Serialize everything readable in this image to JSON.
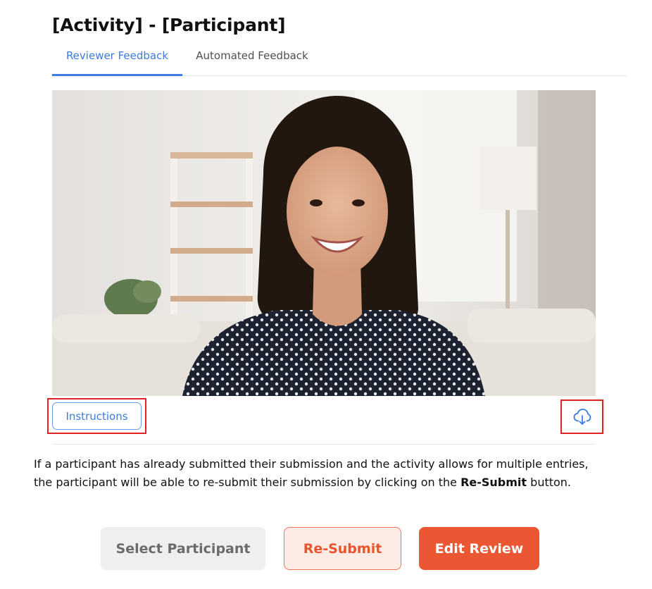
{
  "header": {
    "title": "[Activity] - [Participant]"
  },
  "tabs": [
    {
      "label": "Reviewer Feedback",
      "active": true
    },
    {
      "label": "Automated Feedback",
      "active": false
    }
  ],
  "media": {
    "subject": "smiling woman in polka-dot top sitting on a sofa",
    "instructions_label": "Instructions",
    "download_icon": "cloud-download-icon"
  },
  "description": {
    "line1": "If a participant has already submitted their submission and the activity allows for multiple entries,",
    "line2_prefix": "the participant will be able to re-submit their submission by clicking on the",
    "line2_bold": "Re-Submit",
    "line2_suffix": "button."
  },
  "actions": {
    "select_participant": "Select Participant",
    "resubmit": "Re-Submit",
    "edit_review": "Edit Review"
  },
  "colors": {
    "accent_blue": "#3d7be0",
    "highlight_red": "#e02424",
    "primary_orange": "#ec5733",
    "resubmit_bg": "#fdebe5",
    "neutral_bg": "#efefef"
  }
}
